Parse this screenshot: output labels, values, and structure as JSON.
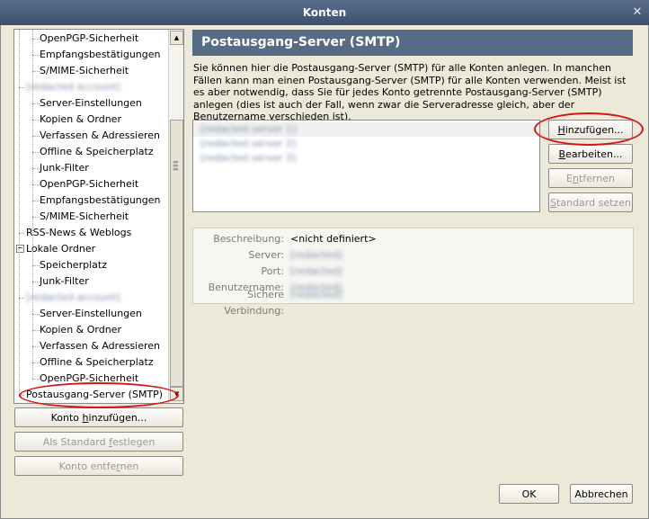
{
  "window": {
    "title": "Konten",
    "close_glyph": "✕"
  },
  "tree": {
    "items": [
      {
        "label": "OpenPGP-Sicherheit",
        "level": 2
      },
      {
        "label": "Empfangsbestätigungen",
        "level": 2
      },
      {
        "label": "S/MIME-Sicherheit",
        "level": 2
      },
      {
        "label": "[redacted account]",
        "level": 1,
        "blurred": true
      },
      {
        "label": "Server-Einstellungen",
        "level": 2
      },
      {
        "label": "Kopien & Ordner",
        "level": 2
      },
      {
        "label": "Verfassen & Adressieren",
        "level": 2
      },
      {
        "label": "Offline & Speicherplatz",
        "level": 2
      },
      {
        "label": "Junk-Filter",
        "level": 2
      },
      {
        "label": "OpenPGP-Sicherheit",
        "level": 2
      },
      {
        "label": "Empfangsbestätigungen",
        "level": 2
      },
      {
        "label": "S/MIME-Sicherheit",
        "level": 2
      },
      {
        "label": "RSS-News & Weblogs",
        "level": 1
      },
      {
        "label": "Lokale Ordner",
        "level": 1,
        "expander": "−"
      },
      {
        "label": "Speicherplatz",
        "level": 2
      },
      {
        "label": "Junk-Filter",
        "level": 2
      },
      {
        "label": "[redacted account]",
        "level": 1,
        "blurred": true
      },
      {
        "label": "Server-Einstellungen",
        "level": 2
      },
      {
        "label": "Kopien & Ordner",
        "level": 2
      },
      {
        "label": "Verfassen & Adressieren",
        "level": 2
      },
      {
        "label": "Offline & Speicherplatz",
        "level": 2
      },
      {
        "label": "OpenPGP-Sicherheit",
        "level": 2
      },
      {
        "label": "Postausgang-Server (SMTP)",
        "level": 1,
        "selected": true
      }
    ]
  },
  "left_buttons": {
    "add_account": {
      "pre": "Konto ",
      "u": "h",
      "post": "inzufügen..."
    },
    "set_default": {
      "pre": "Als Standard ",
      "u": "f",
      "post": "estlegen"
    },
    "remove_account": {
      "pre": "Konto entfe",
      "u": "r",
      "post": "nen"
    }
  },
  "panel": {
    "heading": "Postausgang-Server (SMTP)",
    "description": "Sie können hier die Postausgang-Server (SMTP) für alle Konten anlegen. In manchen Fällen kann man einen Postausgang-Server (SMTP) für alle Konten verwenden. Meist ist es aber notwendig, dass Sie für jedes Konto getrennte Postausgang-Server (SMTP) anlegen (dies ist auch der Fall, wenn zwar die Serveradresse gleich, aber der Benutzername verschieden ist).",
    "smtp_servers": [
      {
        "label": "[redacted server 1]"
      },
      {
        "label": "[redacted server 2]"
      },
      {
        "label": "[redacted server 3]"
      }
    ],
    "buttons": {
      "add": {
        "u": "H",
        "post": "inzufügen..."
      },
      "edit": {
        "u": "B",
        "post": "earbeiten..."
      },
      "remove": {
        "pre": "E",
        "u": "n",
        "post": "tfernen"
      },
      "set_default": {
        "pre": "",
        "u": "S",
        "post": "tandard setzen"
      }
    },
    "details": {
      "description_label": "Beschreibung:",
      "description_value": "<nicht definiert>",
      "server_label": "Server:",
      "server_value": "[redacted]",
      "port_label": "Port:",
      "port_value": "[redacted]",
      "username_label": "Benutzername:",
      "username_value": "[redacted]",
      "security_label": "Sichere Verbindung:",
      "security_value": "[redacted]"
    }
  },
  "footer": {
    "ok": "OK",
    "cancel": "Abbrechen"
  },
  "annotation_color": "#d61515"
}
